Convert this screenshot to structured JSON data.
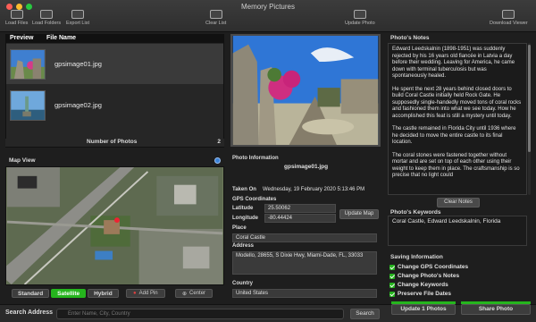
{
  "window": {
    "title": "Memory Pictures"
  },
  "toolbar": {
    "load_files": "Load Files",
    "load_folders": "Load Folders",
    "export_list": "Export List",
    "clear_list": "Clear List",
    "update_photo": "Update Photo",
    "download_viewer": "Download Viewer"
  },
  "list": {
    "col_preview": "Preview",
    "col_filename": "File Name",
    "rows": [
      {
        "filename": "gpsimage01.jpg",
        "selected": true
      },
      {
        "filename": "gpsimage02.jpg",
        "selected": false
      }
    ],
    "count_label": "Number of Photos",
    "count_value": "2"
  },
  "map": {
    "section_label": "Map View",
    "types": [
      "Standard",
      "Satellite",
      "Hybrid"
    ],
    "active_type": "Satellite",
    "add_pin": "Add Pin",
    "center": "Center"
  },
  "search": {
    "label": "Search Address",
    "placeholder": "Enter Name, City, Country",
    "button": "Search"
  },
  "photo_info": {
    "section_label": "Photo Information",
    "filename": "gpsimage01.jpg",
    "taken_on_label": "Taken On",
    "taken_on_value": "Wednesday, 19 February 2020 5:13:46 PM",
    "gps_label": "GPS Coordinates",
    "latitude_label": "Latitude",
    "latitude_value": "25.50062",
    "longitude_label": "Longitude",
    "longitude_value": "-80.44424",
    "update_map": "Update Map",
    "place_label": "Place",
    "place_value": "Coral Castle",
    "address_label": "Address",
    "address_value": "Modello, 28655, S Dixie Hwy, Miami-Dade, FL, 33033",
    "country_label": "Country",
    "country_value": "United States"
  },
  "notes": {
    "section_label": "Photo's Notes",
    "paragraphs": [
      "Edward Leedskalnin (1898-1951) was suddenly rejected by his 16 years old fiancée in Latvia a day before their wedding. Leaving for America, he came down with terminal tuberculosis but was spontaneously healed.",
      "He spent the next 28 years behind closed doors to build Coral Castle initially held Rock Gate. He supposedly single-handedly moved tons of coral rocks and fashioned them into what we see today. How he accomplished this feat is still a mystery until today.",
      "The castle remained in Florida City until 1936 where he decided to move the entire castle to its final location.",
      "The coral stones were fastened together without mortar and are set on top of each other using their weight to keep them in place. The craftsmanship is so precise that no light could"
    ],
    "clear_button": "Clear Notes"
  },
  "keywords": {
    "section_label": "Photo's Keywords",
    "value": "Coral Castle, Edward Leedskalnin, Florida"
  },
  "saving": {
    "section_label": "Saving Information",
    "options": [
      {
        "label": "Change GPS Coordinates",
        "checked": true
      },
      {
        "label": "Change Photo's Notes",
        "checked": true
      },
      {
        "label": "Change Keywords",
        "checked": true
      },
      {
        "label": "Preserve File Dates",
        "checked": true
      }
    ],
    "update_button": "Update 1 Photos",
    "share_button": "Share Photo"
  },
  "colors": {
    "accent_green": "#25b51d",
    "background": "#1e1e1e"
  }
}
